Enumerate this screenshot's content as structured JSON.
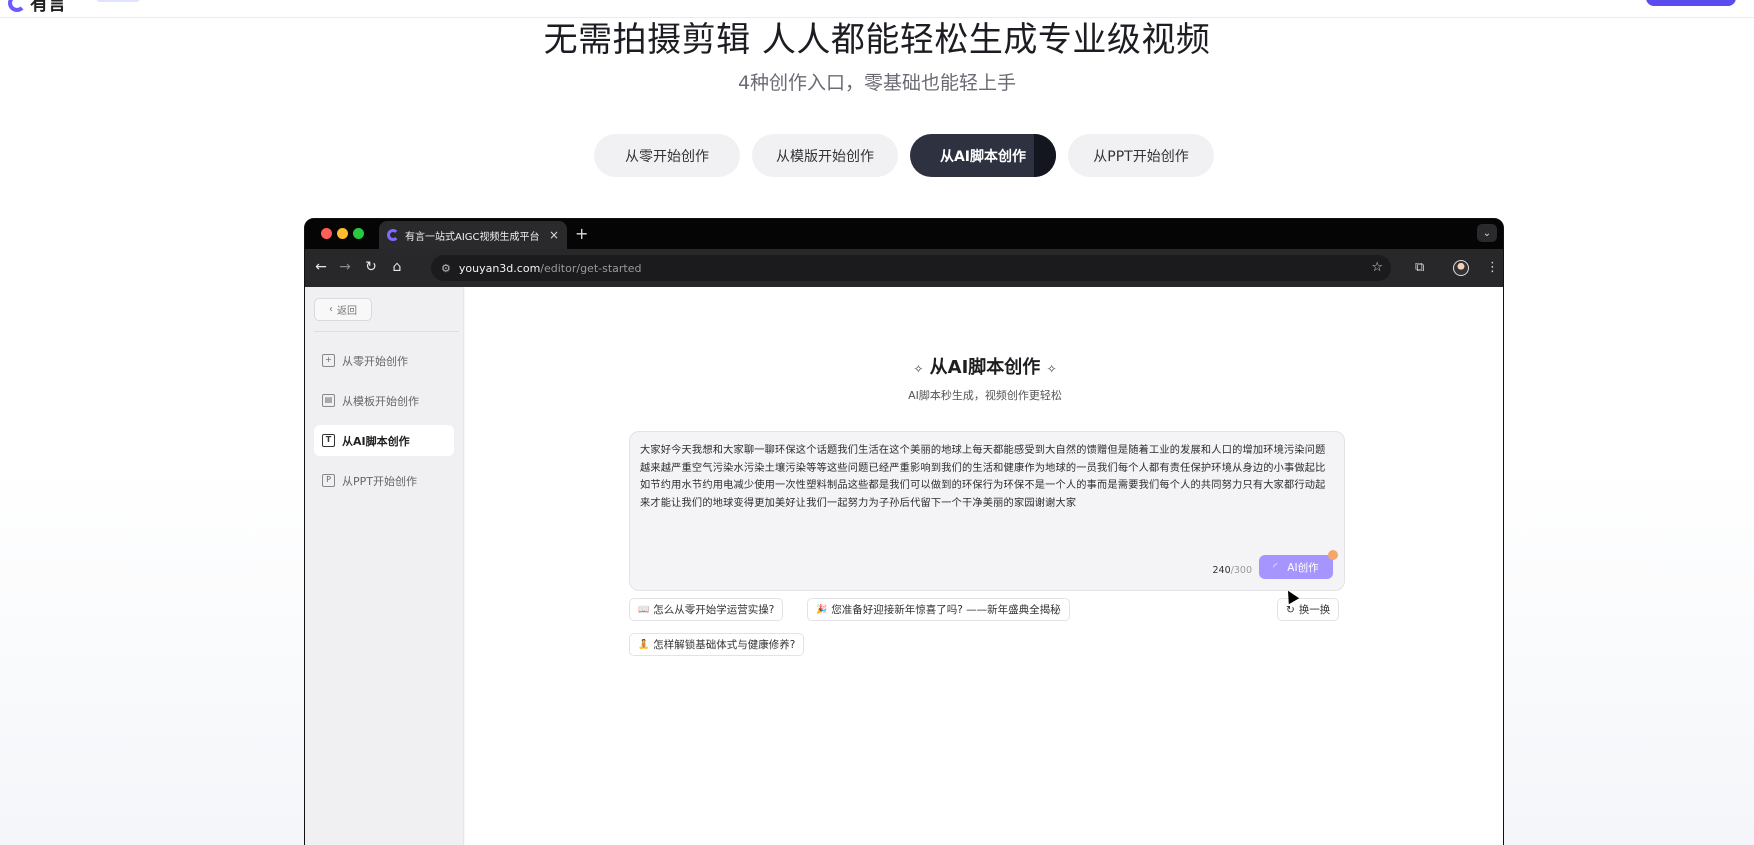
{
  "site": {
    "logo_text": "有言"
  },
  "hero": {
    "title": "无需拍摄剪辑 人人都能轻松生成专业级视频",
    "subtitle": "4种创作入口，零基础也能轻上手",
    "tabs": [
      {
        "label": "从零开始创作",
        "active": false
      },
      {
        "label": "从模版开始创作",
        "active": false
      },
      {
        "label": "从AI脚本创作",
        "active": true
      },
      {
        "label": "从PPT开始创作",
        "active": false
      }
    ]
  },
  "browser": {
    "tab_title": "有言一站式AIGC视频生成平台",
    "tab_close": "×",
    "new_tab": "+",
    "url_domain": "youyan3d.com",
    "url_path": "/editor/get-started"
  },
  "app": {
    "back_label": "返回",
    "sidebar": [
      {
        "label": "从零开始创作",
        "icon": "copy-plus-icon",
        "active": false
      },
      {
        "label": "从模板开始创作",
        "icon": "template-icon",
        "active": false
      },
      {
        "label": "从AI脚本创作",
        "icon": "text-icon",
        "active": true
      },
      {
        "label": "从PPT开始创作",
        "icon": "ppt-icon",
        "active": false
      }
    ],
    "title": "从AI脚本创作",
    "subtitle": "AI脚本秒生成，视频创作更轻松",
    "editor_text": "大家好今天我想和大家聊一聊环保这个话题我们生活在这个美丽的地球上每天都能感受到大自然的馈赠但是随着工业的发展和人口的增加环境污染问题越来越严重空气污染水污染土壤污染等等这些问题已经严重影响到我们的生活和健康作为地球的一员我们每个人都有责任保护环境从身边的小事做起比如节约用水节约用电减少使用一次性塑料制品这些都是我们可以做到的环保行为环保不是一个人的事而是需要我们每个人的共同努力只有大家都行动起来才能让我们的地球变得更加美好让我们一起努力为子孙后代留下一个干净美丽的家园谢谢大家",
    "char_count": "240",
    "char_max": "/300",
    "ai_button": "AI创作",
    "suggestions": [
      {
        "emoji": "📖",
        "text": "怎么从零开始学运营实操?"
      },
      {
        "emoji": "🎉",
        "text": "您准备好迎接新年惊喜了吗? ——新年盛典全揭秘"
      },
      {
        "emoji": "🧘",
        "text": "怎样解锁基础体式与健康修养?"
      }
    ],
    "refresh_label": "换一换"
  }
}
